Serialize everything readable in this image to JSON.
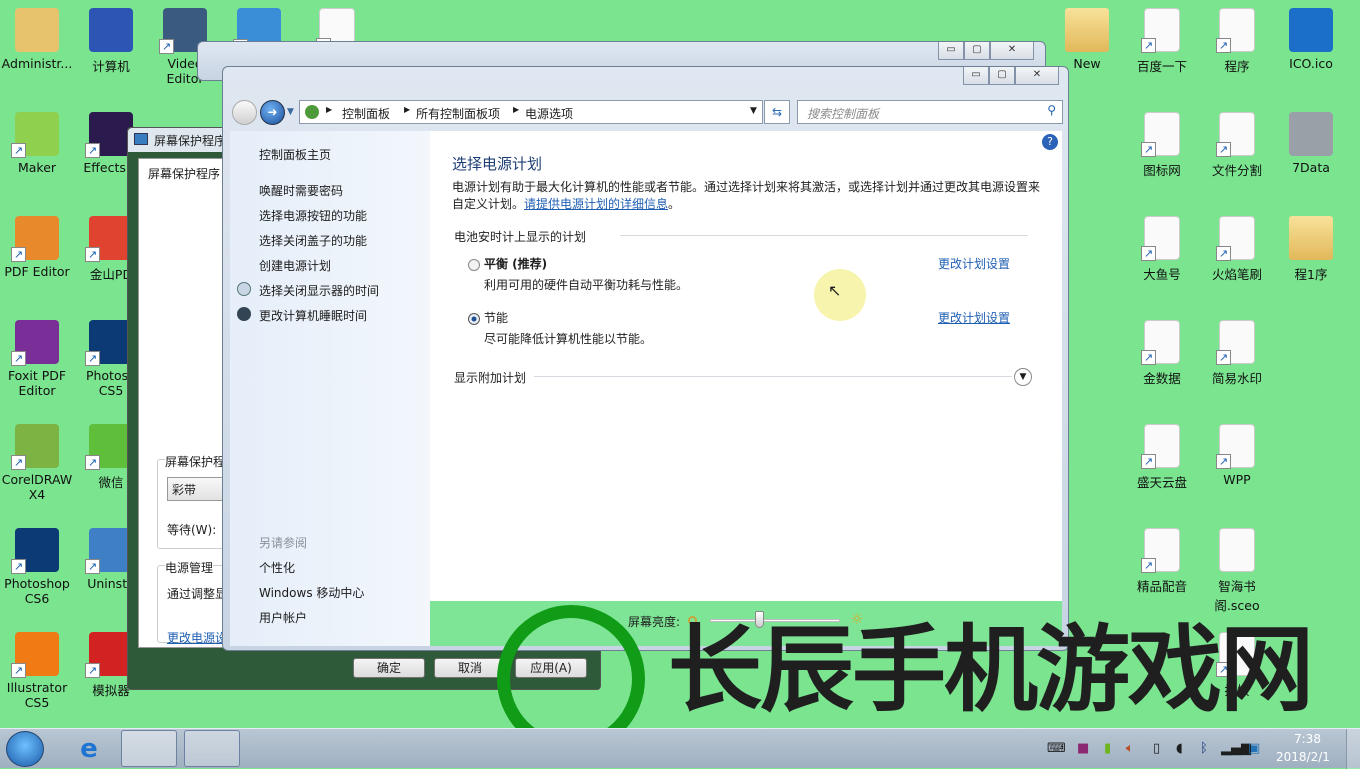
{
  "desktop": {
    "left_icons": [
      {
        "label": "Administr...",
        "type": "user-folder-icon"
      },
      {
        "label": "计算机",
        "type": "computer-icon"
      },
      {
        "label": "Video Editor",
        "type": "video-editor-icon"
      },
      {
        "label": "",
        "type": "network-globe-icon"
      },
      {
        "label": "",
        "type": "html-file-icon"
      },
      {
        "label": "Maker",
        "type": "maker-icon"
      },
      {
        "label": "Effects C",
        "type": "after-effects-icon"
      },
      {
        "label": "PDF Editor",
        "type": "pdf-editor-icon"
      },
      {
        "label": "金山PD",
        "type": "kingsoft-pdf-icon"
      },
      {
        "label": "Foxit PDF Editor",
        "type": "foxit-icon"
      },
      {
        "label": "Photosh CS5",
        "type": "photoshop-icon"
      },
      {
        "label": "CorelDRAW X4",
        "type": "coreldraw-icon"
      },
      {
        "label": "微信",
        "type": "wechat-icon"
      },
      {
        "label": "Photoshop CS6",
        "type": "photoshop-icon"
      },
      {
        "label": "Uninsta",
        "type": "uninstall-icon"
      },
      {
        "label": "Illustrator CS5",
        "type": "illustrator-icon"
      },
      {
        "label": "模拟器",
        "type": "emulator-icon"
      }
    ],
    "right_icons": [
      {
        "label": "New",
        "type": "folder-icon"
      },
      {
        "label": "百度一下",
        "type": "file-shortcut-icon"
      },
      {
        "label": "程序",
        "type": "file-shortcut-icon"
      },
      {
        "label": "ICO.ico",
        "type": "globe-icon"
      },
      {
        "label": "图标网",
        "type": "file-shortcut-icon"
      },
      {
        "label": "文件分割",
        "type": "file-shortcut-icon"
      },
      {
        "label": "7Data",
        "type": "hard-drive-icon"
      },
      {
        "label": "大鱼号",
        "type": "file-shortcut-icon"
      },
      {
        "label": "火焰笔刷",
        "type": "file-shortcut-icon"
      },
      {
        "label": "程1序",
        "type": "folder-icon"
      },
      {
        "label": "金数据",
        "type": "file-shortcut-icon"
      },
      {
        "label": "简易水印",
        "type": "file-shortcut-icon"
      },
      {
        "label": "盛天云盘",
        "type": "file-shortcut-icon"
      },
      {
        "label": "WPP",
        "type": "file-shortcut-icon"
      },
      {
        "label": "精品配音",
        "type": "file-shortcut-icon"
      },
      {
        "label": "智海书阁.sceo",
        "type": "file-icon"
      },
      {
        "label": "据恢",
        "type": "file-shortcut-icon"
      }
    ]
  },
  "screensaver_dialog": {
    "title": "屏幕保护程序",
    "tab": "屏幕保护程序",
    "group_label": "屏幕保护程",
    "selected": "彩带",
    "wait_label": "等待(W):",
    "power_group": "电源管理",
    "power_text": "通过调整显",
    "power_link": "更改电源设",
    "ok": "确定",
    "cancel": "取消",
    "apply": "应用(A)"
  },
  "power_window": {
    "breadcrumb": [
      "控制面板",
      "所有控制面板项",
      "电源选项"
    ],
    "search_placeholder": "搜索控制面板",
    "left_nav": [
      "控制面板主页",
      "唤醒时需要密码",
      "选择电源按钮的功能",
      "选择关闭盖子的功能",
      "创建电源计划",
      "选择关闭显示器的时间",
      "更改计算机睡眠时间"
    ],
    "see_also_title": "另请参阅",
    "see_also": [
      "个性化",
      "Windows 移动中心",
      "用户帐户"
    ],
    "heading": "选择电源计划",
    "description": "电源计划有助于最大化计算机的性能或者节能。通过选择计划来将其激活，或选择计划并通过更改其电源设置来自定义计划。",
    "description_link": "请提供电源计划的详细信息",
    "section_label": "电池安时计上显示的计划",
    "plans": [
      {
        "name": "平衡 (推荐)",
        "desc": "利用可用的硬件自动平衡功耗与性能。",
        "link": "更改计划设置",
        "selected": false
      },
      {
        "name": "节能",
        "desc": "尽可能降低计算机性能以节能。",
        "link": "更改计划设置",
        "selected": true
      }
    ],
    "additional_label": "显示附加计划",
    "brightness_label": "屏幕亮度:",
    "brightness_percent": 38
  },
  "watermark": {
    "text": "长辰手机游戏网"
  },
  "taskbar": {
    "time": "7:38",
    "date": "2018/2/1"
  },
  "colors": {
    "desktop": "#7ae48f",
    "link": "#1f5fb3",
    "dialog_frame": "#2f5a3a"
  }
}
